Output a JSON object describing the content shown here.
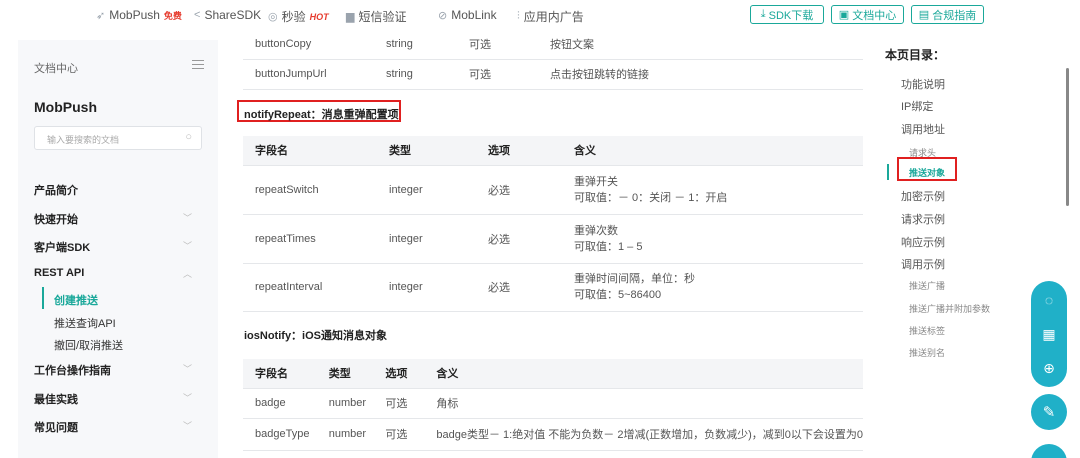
{
  "topnav": {
    "items": [
      {
        "label": "MobPush",
        "badge": "免费"
      },
      {
        "label": "ShareSDK"
      },
      {
        "label": "秒验",
        "badge": "HOT"
      },
      {
        "label": "短信验证"
      },
      {
        "label": "MobLink"
      },
      {
        "label": "应用内广告"
      }
    ],
    "buttons": [
      "SDK下载",
      "文档中心",
      "合规指南"
    ]
  },
  "sidebar": {
    "doc_center": "文档中心",
    "title": "MobPush",
    "search_placeholder": "输入要搜索的文档",
    "items": [
      {
        "label": "产品简介"
      },
      {
        "label": "快速开始"
      },
      {
        "label": "客户端SDK"
      },
      {
        "label": "REST API"
      },
      {
        "label": "工作台操作指南"
      },
      {
        "label": "最佳实践"
      },
      {
        "label": "常见问题"
      }
    ],
    "rest_sub": [
      "创建推送",
      "推送查询API",
      "撤回/取消推送"
    ]
  },
  "content": {
    "top_table": [
      [
        "buttonCopy",
        "string",
        "可选",
        "按钮文案"
      ],
      [
        "buttonJumpUrl",
        "string",
        "可选",
        "点击按钮跳转的链接"
      ]
    ],
    "repeat_title": "notifyRepeat：消息重弹配置项",
    "repeat_headers": [
      "字段名",
      "类型",
      "选项",
      "含义"
    ],
    "repeat_rows": [
      [
        "repeatSwitch",
        "integer",
        "必选",
        "重弹开关",
        "可取值：－ 0：关闭 － 1：开启"
      ],
      [
        "repeatTimes",
        "integer",
        "必选",
        "重弹次数",
        "可取值：1 – 5"
      ],
      [
        "repeatInterval",
        "integer",
        "必选",
        "重弹时间间隔，单位：秒",
        "可取值：5~86400"
      ]
    ],
    "ios_title": "iosNotify：iOS通知消息对象",
    "ios_headers": [
      "字段名",
      "类型",
      "选项",
      "含义"
    ],
    "ios_rows": [
      [
        "badge",
        "number",
        "可选",
        "角标"
      ],
      [
        "badgeType",
        "number",
        "可选",
        "badge类型－ 1:绝对值 不能为负数－ 2增减(正数增加，负数减少)，减到0以下会设置为0"
      ]
    ]
  },
  "toc": {
    "title": "本页目录：",
    "items": [
      "功能说明",
      "IP绑定",
      "调用地址",
      "请求头",
      "推送对象",
      "加密示例",
      "请求示例",
      "响应示例",
      "调用示例",
      "推送广播",
      "推送广播并附加参数",
      "推送标签",
      "推送别名"
    ]
  },
  "colors": {
    "accent": "#1aa89a",
    "highlight_box": "#e02020",
    "fab": "#20b0c8"
  }
}
